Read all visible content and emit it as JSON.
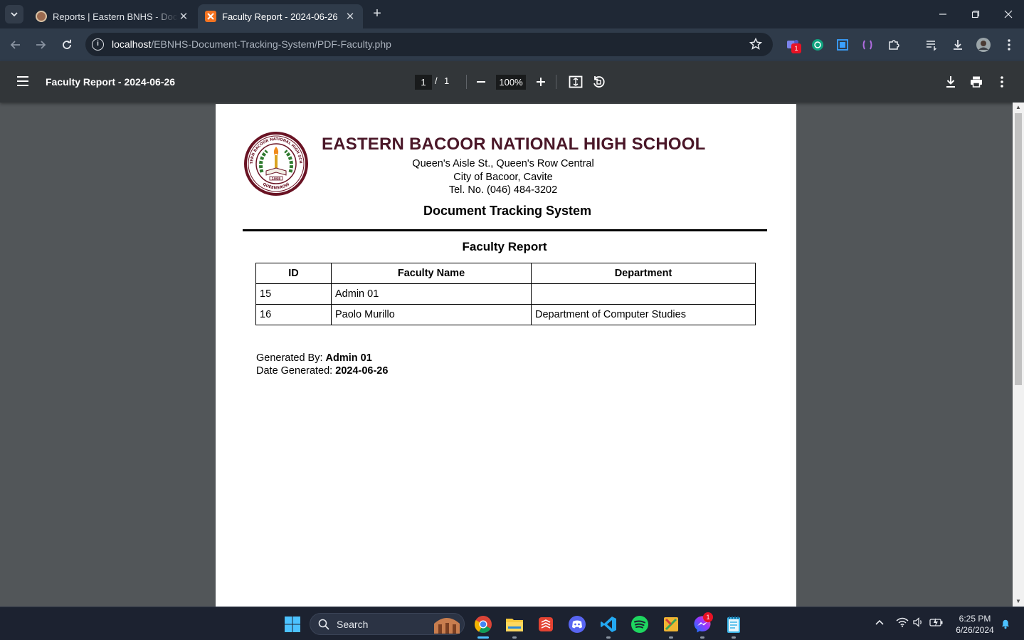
{
  "browser": {
    "tabs": [
      {
        "title": "Reports | Eastern BNHS - Document Tracking System",
        "active": false
      },
      {
        "title": "Faculty Report - 2024-06-26",
        "active": true
      }
    ],
    "url": {
      "host": "localhost",
      "path": "/EBNHS-Document-Tracking-System/PDF-Faculty.php"
    },
    "extension_badge": "1"
  },
  "pdf_viewer": {
    "title": "Faculty Report - 2024-06-26",
    "current_page": "1",
    "page_separator": "/",
    "total_pages": "1",
    "zoom": "100%"
  },
  "document": {
    "seal": {
      "text_top": "EASTERN BACOOR NATIONAL HIGH SCHOOL",
      "year": "1998",
      "text_bottom": "QUEENSROW"
    },
    "school_name": "EASTERN BACOOR NATIONAL HIGH SCHOOL",
    "address_line1": "Queen's Aisle St., Queen's Row Central",
    "address_line2": "City of Bacoor, Cavite",
    "phone": "Tel. No. (046) 484-3202",
    "system_name": "Document Tracking System",
    "report_title": "Faculty Report",
    "table": {
      "headers": [
        "ID",
        "Faculty Name",
        "Department"
      ],
      "rows": [
        [
          "15",
          "Admin 01",
          ""
        ],
        [
          "16",
          "Paolo Murillo",
          "Department of Computer Studies"
        ]
      ]
    },
    "generated_by_label": "Generated By:",
    "generated_by": "Admin 01",
    "date_generated_label": "Date Generated:",
    "date_generated": "2024-06-26"
  },
  "taskbar": {
    "search_label": "Search",
    "messenger_badge": "1",
    "time": "6:25 PM",
    "date": "6/26/2024"
  },
  "colors": {
    "school_name": "#4a1728",
    "tabstrip": "#1f2835",
    "toolbar": "#2f3b4a",
    "pdf_toolbar": "#323639",
    "viewer_bg": "#525659",
    "taskbar": "#1c2230"
  }
}
